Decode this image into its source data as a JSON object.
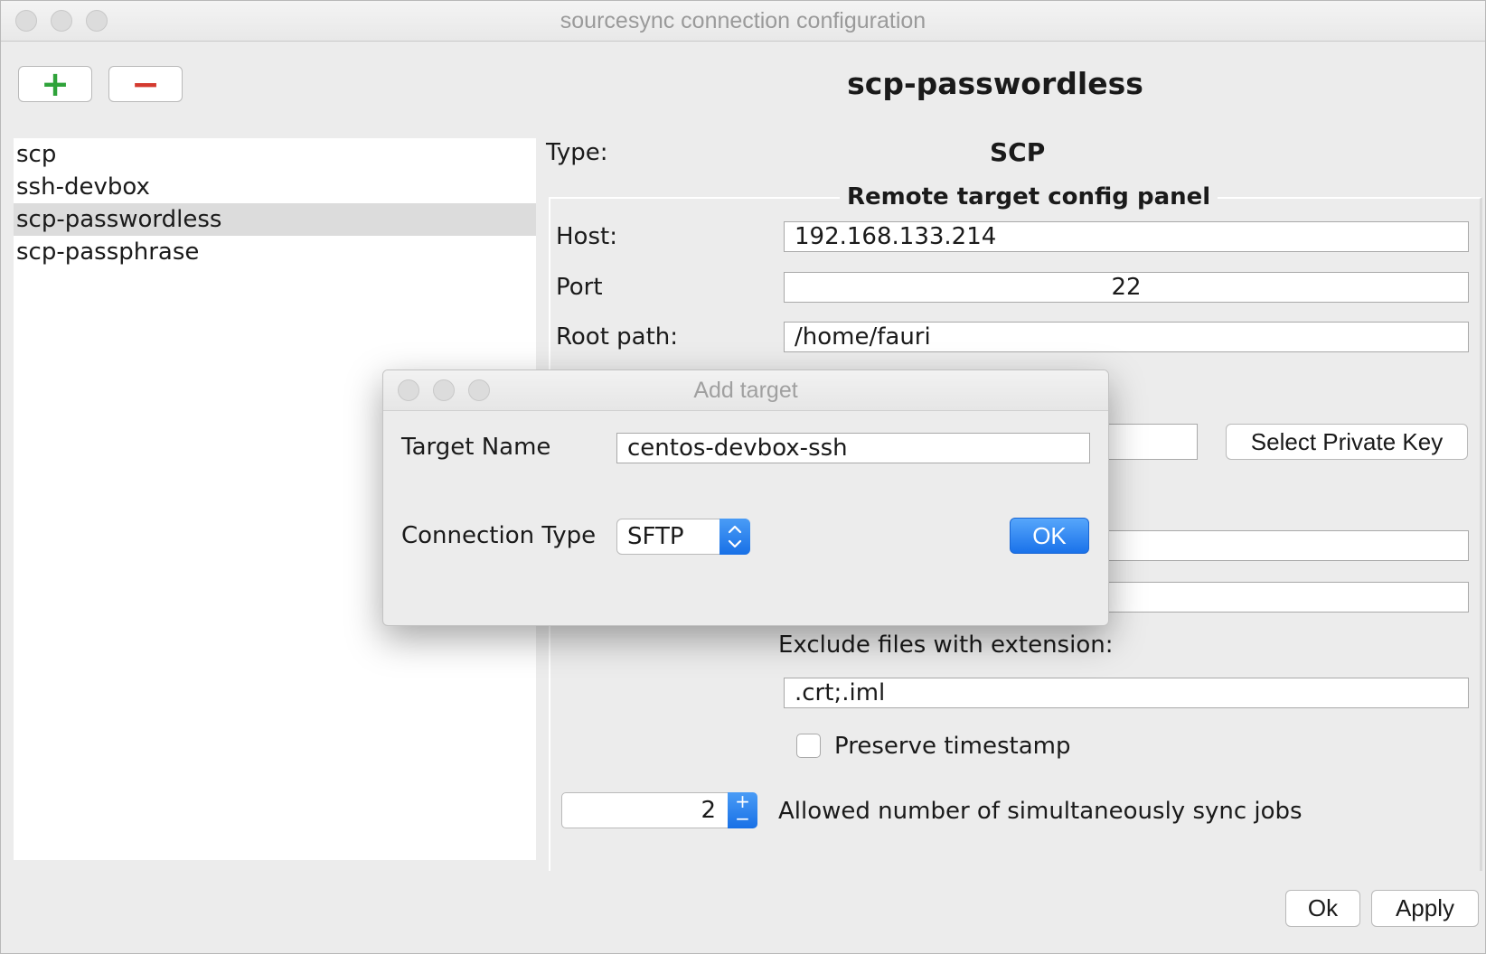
{
  "window": {
    "title": "sourcesync connection configuration"
  },
  "toolbar": {
    "add_symbol": "+",
    "remove_symbol": "−"
  },
  "sidebar": {
    "items": [
      {
        "label": "scp"
      },
      {
        "label": "ssh-devbox"
      },
      {
        "label": "scp-passwordless",
        "selected": true
      },
      {
        "label": "scp-passphrase"
      }
    ]
  },
  "main": {
    "heading": "scp-passwordless",
    "type_label": "Type:",
    "type_value": "SCP",
    "panel_title": "Remote target config panel",
    "host_label": "Host:",
    "host_value": "192.168.133.214",
    "port_label": "Port",
    "port_value": "22",
    "root_path_label": "Root path:",
    "root_path_value": "/home/fauri",
    "select_key_button": "Select Private Key",
    "exclude_label": "Exclude files with extension:",
    "exclude_value": ".crt;.iml",
    "preserve_timestamp_label": "Preserve timestamp",
    "sync_jobs_value": "2",
    "sync_jobs_label": "Allowed number of simultaneously sync jobs"
  },
  "footer": {
    "ok_label": "Ok",
    "apply_label": "Apply"
  },
  "dialog": {
    "title": "Add target",
    "target_name_label": "Target Name",
    "target_name_value": "centos-devbox-ssh",
    "connection_type_label": "Connection Type",
    "connection_type_value": "SFTP",
    "ok_label": "OK"
  },
  "colors": {
    "accent": "#1a72ea",
    "add_green": "#2fa33a",
    "remove_red": "#d43a2f"
  },
  "spinner": {
    "up_symbol": "+",
    "down_symbol": "−"
  }
}
